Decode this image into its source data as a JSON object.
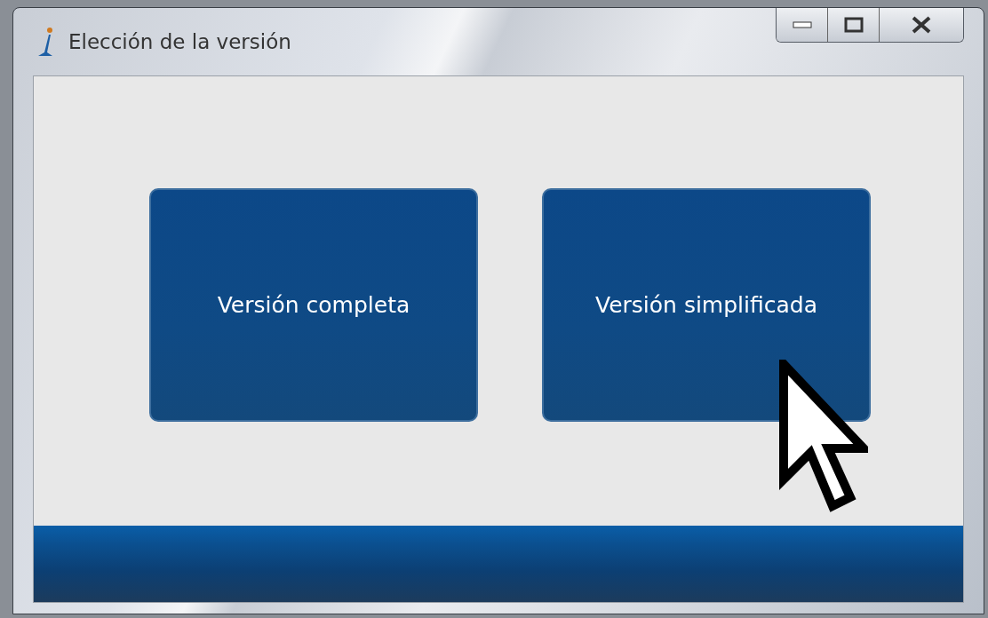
{
  "window": {
    "title": "Elección de la versión"
  },
  "buttons": [
    {
      "label": "Versión completa"
    },
    {
      "label": "Versión simplificada"
    }
  ]
}
